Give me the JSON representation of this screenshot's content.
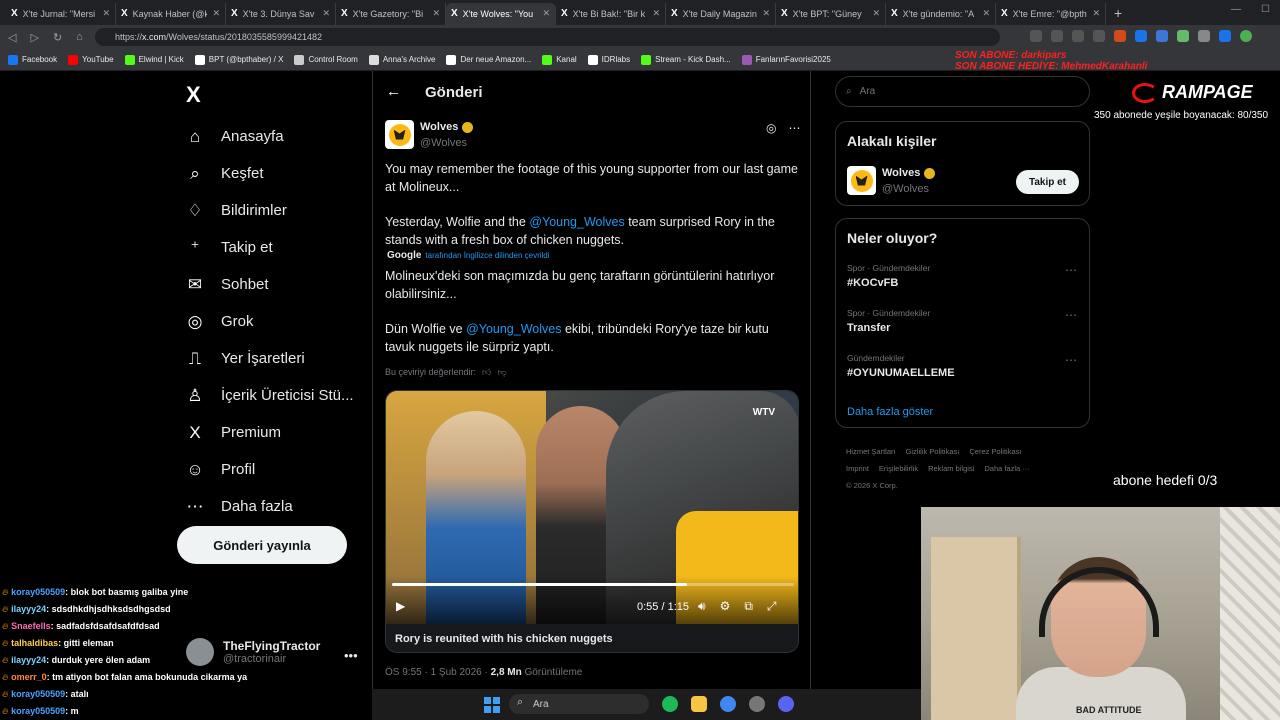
{
  "browser": {
    "tabs": [
      {
        "label": "X'te Jurnal: \"Mersi",
        "active": false
      },
      {
        "label": "Kaynak Haber (@k",
        "active": false
      },
      {
        "label": "X'te 3. Dünya Sav",
        "active": false
      },
      {
        "label": "X'te Gazetory: \"Bi",
        "active": false
      },
      {
        "label": "X'te Wolves: \"You",
        "active": true
      },
      {
        "label": "X'te Bi Bak!: \"Bir k",
        "active": false
      },
      {
        "label": "X'te Daily Magazin",
        "active": false
      },
      {
        "label": "X'te BPT: \"Güney",
        "active": false
      },
      {
        "label": "X'te gündemio: \"A",
        "active": false
      },
      {
        "label": "X'te Emre: \"@bpth",
        "active": false
      }
    ],
    "url_prefix": "https://",
    "url_host": "x.com",
    "url_path": "/Wolves/status/2018035585999421482",
    "bookmarks": [
      {
        "label": "Facebook",
        "color": "#1877f2"
      },
      {
        "label": "YouTube",
        "color": "#ff0000"
      },
      {
        "label": "Elwind | Kick",
        "color": "#53fc18"
      },
      {
        "label": "BPT (@bpthaber) / X",
        "color": "#ffffff"
      },
      {
        "label": "Control Room",
        "color": "#cccccc"
      },
      {
        "label": "Anna's Archive",
        "color": "#dddddd"
      },
      {
        "label": "Der neue Amazon...",
        "color": "#ffffff"
      },
      {
        "label": "Kanal",
        "color": "#53fc18"
      },
      {
        "label": "IDRlabs",
        "color": "#ffffff"
      },
      {
        "label": "Stream - Kick Dash...",
        "color": "#53fc18"
      },
      {
        "label": "FanlarınFavorisi2025",
        "color": "#9b59b6"
      }
    ]
  },
  "stream_overlay": {
    "son_abone": "SON ABONE: darkipars",
    "son_abone_hediye": "SON ABONE HEDİYE: MehmedKarahanli",
    "brand": "RAMPAGE",
    "sub_goal": "350 abonede yeşile boyanacak: 80/350",
    "abone_hedefi": "abone hedefi 0/3"
  },
  "sidebar": {
    "logo": "X",
    "items": [
      {
        "label": "Anasayfa",
        "icon": "home-icon",
        "glyph": "⌂"
      },
      {
        "label": "Keşfet",
        "icon": "search-icon",
        "glyph": "⌕"
      },
      {
        "label": "Bildirimler",
        "icon": "bell-icon",
        "glyph": "♢"
      },
      {
        "label": "Takip et",
        "icon": "follow-icon",
        "glyph": "⁺"
      },
      {
        "label": "Sohbet",
        "icon": "mail-icon",
        "glyph": "✉"
      },
      {
        "label": "Grok",
        "icon": "grok-icon",
        "glyph": "◎"
      },
      {
        "label": "Yer İşaretleri",
        "icon": "bookmark-icon",
        "glyph": "⎍"
      },
      {
        "label": "İçerik Üreticisi Stü...",
        "icon": "creator-icon",
        "glyph": "♙"
      },
      {
        "label": "Premium",
        "icon": "x-premium-icon",
        "glyph": "X"
      },
      {
        "label": "Profil",
        "icon": "profile-icon",
        "glyph": "☺"
      },
      {
        "label": "Daha fazla",
        "icon": "more-circle-icon",
        "glyph": "⋯"
      }
    ],
    "post_button": "Gönderi yayınla",
    "account_name": "TheFlyingTractor",
    "account_handle": "@tractorinair"
  },
  "chat": [
    {
      "user": "koray050509",
      "color": "#4aa3ff",
      "msg": ": blok bot basmış galiba yine"
    },
    {
      "user": "ilayyy24",
      "color": "#7ad3ff",
      "msg": ": sdsdhkdhjsdhksdsdhgsdsd"
    },
    {
      "user": "Snaefells",
      "color": "#ff69b4",
      "msg": ": sadfadsfdsafdsafdfdsad"
    },
    {
      "user": "talhaldibas",
      "color": "#ffd24a",
      "msg": ": gitti eleman"
    },
    {
      "user": "ilayyy24",
      "color": "#7ad3ff",
      "msg": ": durduk yere ölen adam"
    },
    {
      "user": "omerr_0",
      "color": "#ff8c3a",
      "msg": ": tm atiyon bot falan ama bokunuda cikarma ya"
    },
    {
      "user": "koray050509",
      "color": "#4aa3ff",
      "msg": ": atalı"
    },
    {
      "user": "koray050509",
      "color": "#4aa3ff",
      "msg": ": m"
    }
  ],
  "main": {
    "title": "Gönderi",
    "author_name": "Wolves",
    "author_handle": "@Wolves",
    "text_p1": "You may remember the footage of this young supporter from our last game at Molineux...",
    "text_p2_a": "Yesterday, Wolfie and the ",
    "text_p2_link": "@Young_Wolves",
    "text_p2_b": " team surprised Rory in the stands with a fresh box of chicken nuggets.",
    "google_label": "Google",
    "google_note": "tarafından İngilizce dilinden çevrildi",
    "tr_p1": "Molineux'deki son maçımızda bu genç taraftarın görüntülerini hatırlıyor olabilirsiniz...",
    "tr_p2_a": "Dün Wolfie ve ",
    "tr_p2_link": "@Young_Wolves",
    "tr_p2_b": " ekibi, tribündeki Rory'ye taze bir kutu tavuk nuggets ile sürpriz yaptı.",
    "rate_label": "Bu çeviriyi değerlendir:",
    "video": {
      "badge": "WTV",
      "time": "0:55 / 1:15",
      "progress_fraction": 0.733,
      "caption": "Rory is reunited with his chicken nuggets"
    },
    "meta_time": "ÖS 9:55 · 1 Şub 2026 · ",
    "meta_views": "2,8 Mn",
    "meta_views_label": " Görüntüleme"
  },
  "right": {
    "search_placeholder": "Ara",
    "related_title": "Alakalı kişiler",
    "related_name": "Wolves",
    "related_handle": "@Wolves",
    "follow_label": "Takip et",
    "trends_title": "Neler oluyor?",
    "trends": [
      {
        "category": "Spor · Gündemdekiler",
        "tag": "#KOCvFB"
      },
      {
        "category": "Spor · Gündemdekiler",
        "tag": "Transfer"
      },
      {
        "category": "Gündemdekiler",
        "tag": "#OYUNUMAELLEME"
      }
    ],
    "show_more": "Daha fazla göster",
    "footer": [
      "Hizmet Şartları",
      "Gizlilik Politikası",
      "Çerez Politikası",
      "Imprint",
      "Erişilebilirlik",
      "Reklam bilgisi",
      "Daha fazla ···",
      "© 2026 X Corp."
    ]
  },
  "webcam": {
    "shirt_text": "BAD ATTITUDE"
  },
  "taskbar": {
    "search_label": "Ara"
  }
}
